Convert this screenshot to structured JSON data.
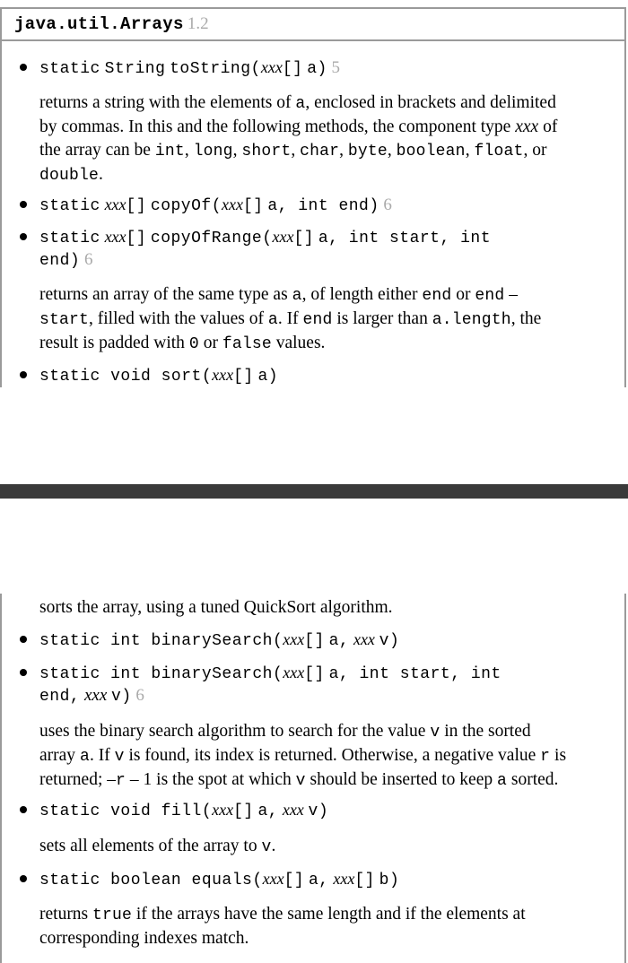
{
  "header": {
    "class_name": "java.util.Arrays",
    "version": "1.2"
  },
  "entries": {
    "toString": {
      "static": "static",
      "ret": "String",
      "name": "toString",
      "type": "xxx",
      "brackets": "[]",
      "param": "a)",
      "version": "5"
    },
    "toString_desc": {
      "l1a": "returns a string with the elements of ",
      "l1b": "a",
      "l1c": ", enclosed in brackets and delimited",
      "l2a": "by commas. In this and the following methods, the component type ",
      "l2b": "xxx",
      "l2c": " of",
      "l3a": "the array can be ",
      "l3b": "int",
      "l3c": ", ",
      "l3d": "long",
      "l3e": ", ",
      "l3f": "short",
      "l3g": ", ",
      "l3h": "char",
      "l3i": ", ",
      "l3j": "byte",
      "l3k": ", ",
      "l3l": "boolean",
      "l3m": ", ",
      "l3n": "float",
      "l3o": ", or",
      "l4a": "double",
      "l4b": "."
    },
    "copyOf": {
      "static": "static",
      "type": "xxx",
      "ret_br": "[]",
      "name": "copyOf",
      "ptype": "xxx",
      "pbr": "[]",
      "rest": "a, int end)",
      "version": "6"
    },
    "copyOfRange": {
      "static": "static",
      "type": "xxx",
      "ret_br": "[]",
      "name": "copyOfRange",
      "ptype": "xxx",
      "pbr": "[]",
      "rest": "a, int start, int",
      "cont": "end)",
      "version": "6"
    },
    "copy_desc": {
      "l1a": "returns an array of the same type as ",
      "l1b": "a",
      "l1c": ", of length either ",
      "l1d": "end",
      "l1e": " or ",
      "l1f": "end",
      "l1g": " –",
      "l2a": "start",
      "l2b": ", filled with the values of ",
      "l2c": "a",
      "l2d": ". If ",
      "l2e": "end",
      "l2f": " is larger than ",
      "l2g": "a.length",
      "l2h": ", the",
      "l3a": "result is padded with ",
      "l3b": "0",
      "l3c": " or ",
      "l3d": "false",
      "l3e": " values."
    },
    "sort": {
      "sig1": "static void sort",
      "type": "xxx",
      "brackets": "[]",
      "param": "a)"
    },
    "sort_desc": "sorts the array, using a tuned QuickSort algorithm.",
    "binarySearch1": {
      "sig1": "static int binarySearch",
      "type": "xxx",
      "brackets": "[]",
      "mid": "a,",
      "vtype": "xxx",
      "end": "v)"
    },
    "binarySearch2": {
      "sig1": "static int binarySearch",
      "type": "xxx",
      "brackets": "[]",
      "rest": "a, int start, int",
      "cont1": "end,",
      "vtype": "xxx",
      "cont2": "v)",
      "version": "6"
    },
    "bs_desc": {
      "l1a": "uses the binary search algorithm to search for the value ",
      "l1b": "v",
      "l1c": " in the sorted",
      "l2a": "array ",
      "l2b": "a",
      "l2c": ". If ",
      "l2d": "v",
      "l2e": " is found, its index is returned. Otherwise, a negative value ",
      "l2f": "r",
      "l2g": " is",
      "l3a": "returned; –",
      "l3b": "r",
      "l3c": " – 1 is the spot at which ",
      "l3d": "v",
      "l3e": " should be inserted to keep ",
      "l3f": "a",
      "l3g": " sorted."
    },
    "fill": {
      "sig1": "static void fill",
      "type": "xxx",
      "brackets": "[]",
      "mid": "a,",
      "vtype": "xxx",
      "end": "v)"
    },
    "fill_desc": {
      "a": "sets all elements of the array to ",
      "b": "v",
      "c": "."
    },
    "equals": {
      "sig1": "static boolean equals",
      "type1": "xxx",
      "br1": "[]",
      "mid": "a,",
      "type2": "xxx",
      "br2": "[]",
      "end": "b)"
    },
    "equals_desc": {
      "l1a": "returns ",
      "l1b": "true",
      "l1c": " if the arrays have the same length and if the elements at",
      "l2": "corresponding indexes match."
    }
  }
}
